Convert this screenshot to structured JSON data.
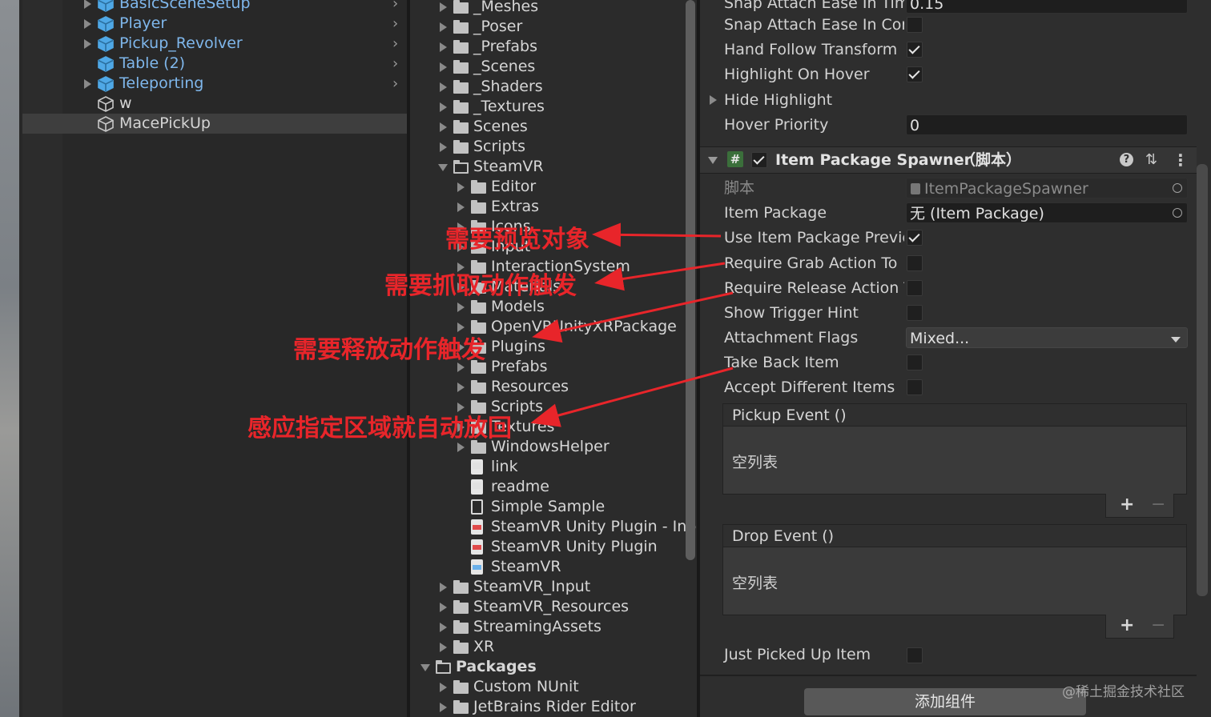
{
  "hierarchy": {
    "items": [
      {
        "label": "BasicSceneSetup",
        "expandable": true,
        "prefab": true
      },
      {
        "label": "Player",
        "expandable": true,
        "prefab": true
      },
      {
        "label": "Pickup_Revolver",
        "expandable": true,
        "prefab": true
      },
      {
        "label": "Table (2)",
        "expandable": false,
        "prefab": true
      },
      {
        "label": "Teleporting",
        "expandable": true,
        "prefab": true
      },
      {
        "label": "w",
        "expandable": false,
        "prefab": false
      },
      {
        "label": "MacePickUp",
        "expandable": false,
        "prefab": false,
        "selected": true
      }
    ]
  },
  "project": {
    "items": [
      {
        "label": "_Meshes",
        "indent": 1,
        "type": "folder"
      },
      {
        "label": "_Poser",
        "indent": 1,
        "type": "folder"
      },
      {
        "label": "_Prefabs",
        "indent": 1,
        "type": "folder"
      },
      {
        "label": "_Scenes",
        "indent": 1,
        "type": "folder"
      },
      {
        "label": "_Shaders",
        "indent": 1,
        "type": "folder"
      },
      {
        "label": "_Textures",
        "indent": 1,
        "type": "folder"
      },
      {
        "label": "Scenes",
        "indent": 1,
        "type": "folder"
      },
      {
        "label": "Scripts",
        "indent": 1,
        "type": "folder"
      },
      {
        "label": "SteamVR",
        "indent": 1,
        "type": "folder-open"
      },
      {
        "label": "Editor",
        "indent": 2,
        "type": "folder"
      },
      {
        "label": "Extras",
        "indent": 2,
        "type": "folder"
      },
      {
        "label": "Icons",
        "indent": 2,
        "type": "folder"
      },
      {
        "label": "Input",
        "indent": 2,
        "type": "folder"
      },
      {
        "label": "InteractionSystem",
        "indent": 2,
        "type": "folder"
      },
      {
        "label": "Materials",
        "indent": 2,
        "type": "folder"
      },
      {
        "label": "Models",
        "indent": 2,
        "type": "folder"
      },
      {
        "label": "OpenVRUnityXRPackage",
        "indent": 2,
        "type": "folder"
      },
      {
        "label": "Plugins",
        "indent": 2,
        "type": "folder"
      },
      {
        "label": "Prefabs",
        "indent": 2,
        "type": "folder"
      },
      {
        "label": "Resources",
        "indent": 2,
        "type": "folder"
      },
      {
        "label": "Scripts",
        "indent": 2,
        "type": "folder"
      },
      {
        "label": "Textures",
        "indent": 2,
        "type": "folder"
      },
      {
        "label": "WindowsHelper",
        "indent": 2,
        "type": "folder"
      },
      {
        "label": "link",
        "indent": 2,
        "type": "file"
      },
      {
        "label": "readme",
        "indent": 2,
        "type": "file"
      },
      {
        "label": "Simple Sample",
        "indent": 2,
        "type": "scene"
      },
      {
        "label": "SteamVR Unity Plugin - Inp",
        "indent": 2,
        "type": "pdf"
      },
      {
        "label": "SteamVR Unity Plugin",
        "indent": 2,
        "type": "pdf"
      },
      {
        "label": "SteamVR",
        "indent": 2,
        "type": "asset"
      },
      {
        "label": "SteamVR_Input",
        "indent": 1,
        "type": "folder"
      },
      {
        "label": "SteamVR_Resources",
        "indent": 1,
        "type": "folder"
      },
      {
        "label": "StreamingAssets",
        "indent": 1,
        "type": "folder"
      },
      {
        "label": "XR",
        "indent": 1,
        "type": "folder"
      },
      {
        "label": "Packages",
        "indent": 0,
        "type": "folder-open",
        "bold": true
      },
      {
        "label": "Custom NUnit",
        "indent": 1,
        "type": "folder"
      },
      {
        "label": "JetBrains Rider Editor",
        "indent": 1,
        "type": "folder"
      }
    ]
  },
  "inspector": {
    "top_rows": [
      {
        "label": "Snap Attach Ease In Time",
        "kind": "field",
        "value": "0.15"
      },
      {
        "label": "Snap Attach Ease In Com",
        "kind": "check",
        "checked": false
      },
      {
        "label": "Hand Follow Transform",
        "kind": "check",
        "checked": true
      },
      {
        "label": "Highlight On Hover",
        "kind": "check",
        "checked": true
      },
      {
        "label": "Hide Highlight",
        "kind": "foldout"
      },
      {
        "label": "Hover Priority",
        "kind": "field",
        "value": "0"
      }
    ],
    "component": {
      "hash_icon": "#",
      "title": "Item Package Spawner",
      "suffix": "（脚本）",
      "help_icon": "?",
      "settings_icon": "⇅",
      "menu_icon": "⋮"
    },
    "rows": [
      {
        "label": "脚本",
        "kind": "objref",
        "value": "ItemPackageSpawner",
        "dim": true
      },
      {
        "label": "Item Package",
        "kind": "objref",
        "value": "无 (Item Package)"
      },
      {
        "label": "Use Item Package Previe",
        "kind": "check",
        "checked": true
      },
      {
        "label": "Require Grab Action To",
        "kind": "check",
        "checked": false
      },
      {
        "label": "Require Release Action T",
        "kind": "check",
        "checked": false
      },
      {
        "label": "Show Trigger Hint",
        "kind": "check",
        "checked": false
      },
      {
        "label": "Attachment Flags",
        "kind": "dropdown",
        "value": "Mixed..."
      },
      {
        "label": "Take Back Item",
        "kind": "check",
        "checked": false
      },
      {
        "label": "Accept Different Items",
        "kind": "check",
        "checked": false
      }
    ],
    "events": [
      {
        "title": "Pickup Event ()",
        "empty": "空列表"
      },
      {
        "title": "Drop Event ()",
        "empty": "空列表"
      }
    ],
    "plus": "+",
    "minus": "−",
    "just_picked": {
      "label": "Just Picked Up Item",
      "checked": false
    },
    "add_component": "添加组件"
  },
  "annotations": {
    "a1": "需要预览对象",
    "a2": "需要抓取动作触发",
    "a3": "需要释放动作触发",
    "a4": "感应指定区域就自动放回"
  },
  "watermark": "@稀土掘金技术社区"
}
